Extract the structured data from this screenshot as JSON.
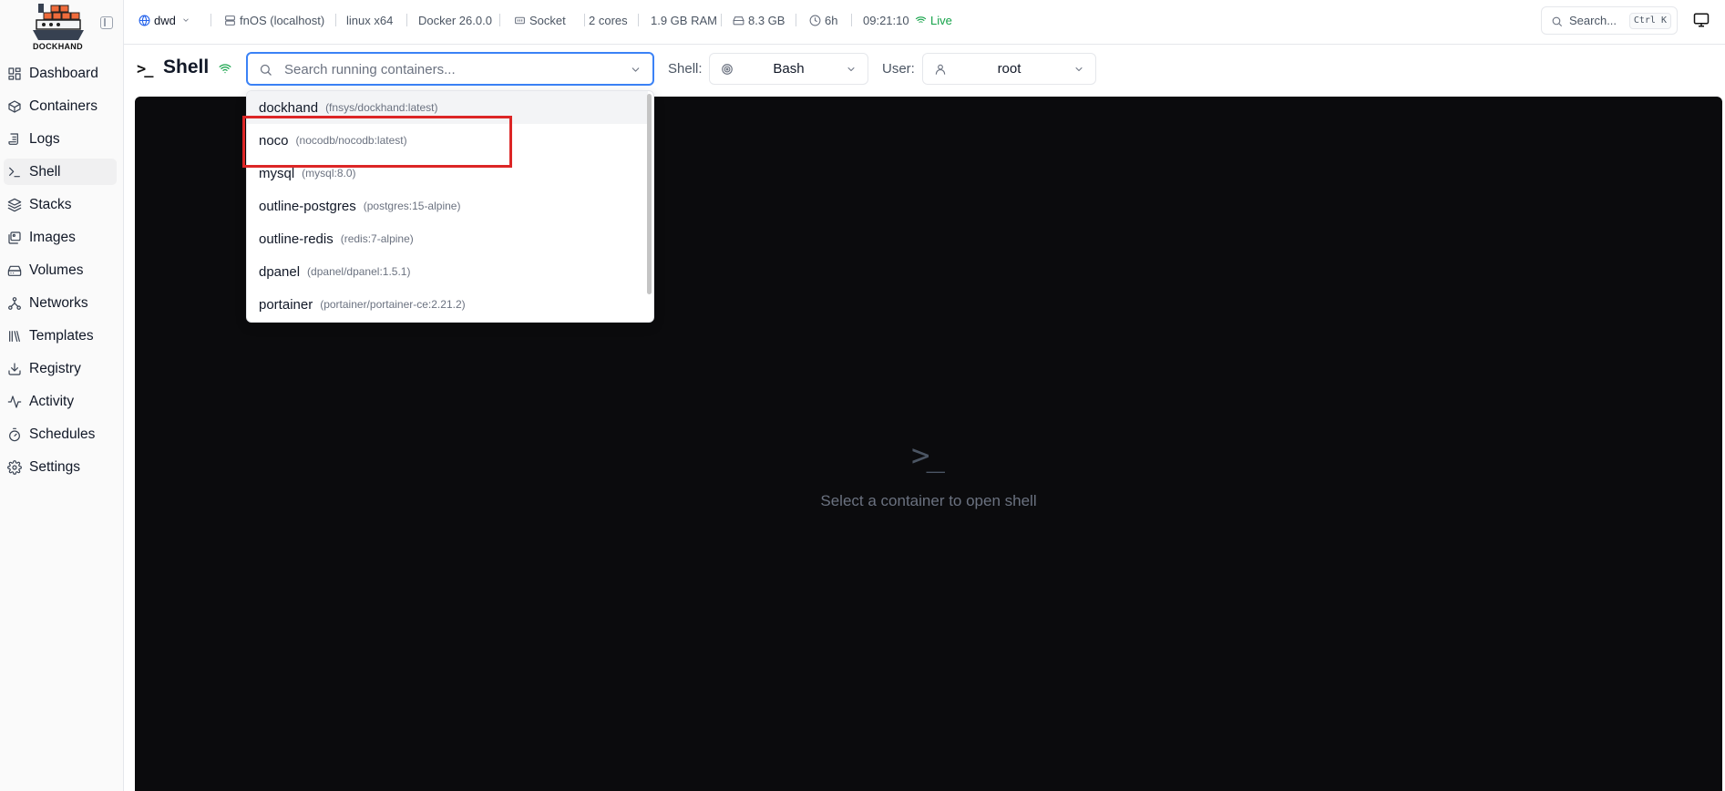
{
  "app": {
    "logo_text": "DOCKHAND"
  },
  "sidebar": {
    "items": [
      {
        "label": "Dashboard",
        "icon": "dashboard-icon"
      },
      {
        "label": "Containers",
        "icon": "box-icon"
      },
      {
        "label": "Logs",
        "icon": "logs-icon"
      },
      {
        "label": "Shell",
        "icon": "terminal-icon",
        "active": true
      },
      {
        "label": "Stacks",
        "icon": "layers-icon"
      },
      {
        "label": "Images",
        "icon": "images-icon"
      },
      {
        "label": "Volumes",
        "icon": "hard-drive-icon"
      },
      {
        "label": "Networks",
        "icon": "network-icon"
      },
      {
        "label": "Templates",
        "icon": "library-icon"
      },
      {
        "label": "Registry",
        "icon": "download-icon"
      },
      {
        "label": "Activity",
        "icon": "activity-icon"
      },
      {
        "label": "Schedules",
        "icon": "timer-icon"
      },
      {
        "label": "Settings",
        "icon": "gear-icon"
      }
    ]
  },
  "topbar": {
    "environment": "dwd",
    "host": "fnOS (localhost)",
    "platform": "linux x64",
    "docker": "Docker 26.0.0",
    "connection": "Socket",
    "cores": "2 cores",
    "ram": "1.9 GB RAM",
    "disk": "8.3 GB",
    "uptime": "6h",
    "time": "09:21:10",
    "live": "Live",
    "search_label": "Search...",
    "shortcut": "Ctrl K"
  },
  "page": {
    "title": "Shell",
    "container_search_placeholder": "Search running containers...",
    "shell_label": "Shell:",
    "shell_value": "Bash",
    "user_label": "User:",
    "user_value": "root"
  },
  "dropdown": {
    "items": [
      {
        "name": "dockhand",
        "image": "(fnsys/dockhand:latest)"
      },
      {
        "name": "noco",
        "image": "(nocodb/nocodb:latest)"
      },
      {
        "name": "mysql",
        "image": "(mysql:8.0)"
      },
      {
        "name": "outline-postgres",
        "image": "(postgres:15-alpine)"
      },
      {
        "name": "outline-redis",
        "image": "(redis:7-alpine)"
      },
      {
        "name": "dpanel",
        "image": "(dpanel/dpanel:1.5.1)"
      },
      {
        "name": "portainer",
        "image": "(portainer/portainer-ce:2.21.2)"
      }
    ]
  },
  "terminal": {
    "prompt_glyph": ">_",
    "message": "Select a container to open shell"
  },
  "colors": {
    "accent": "#3b82f6",
    "live": "#16a34a",
    "highlight": "#dc2626",
    "terminal_bg": "#0b0b0d"
  }
}
